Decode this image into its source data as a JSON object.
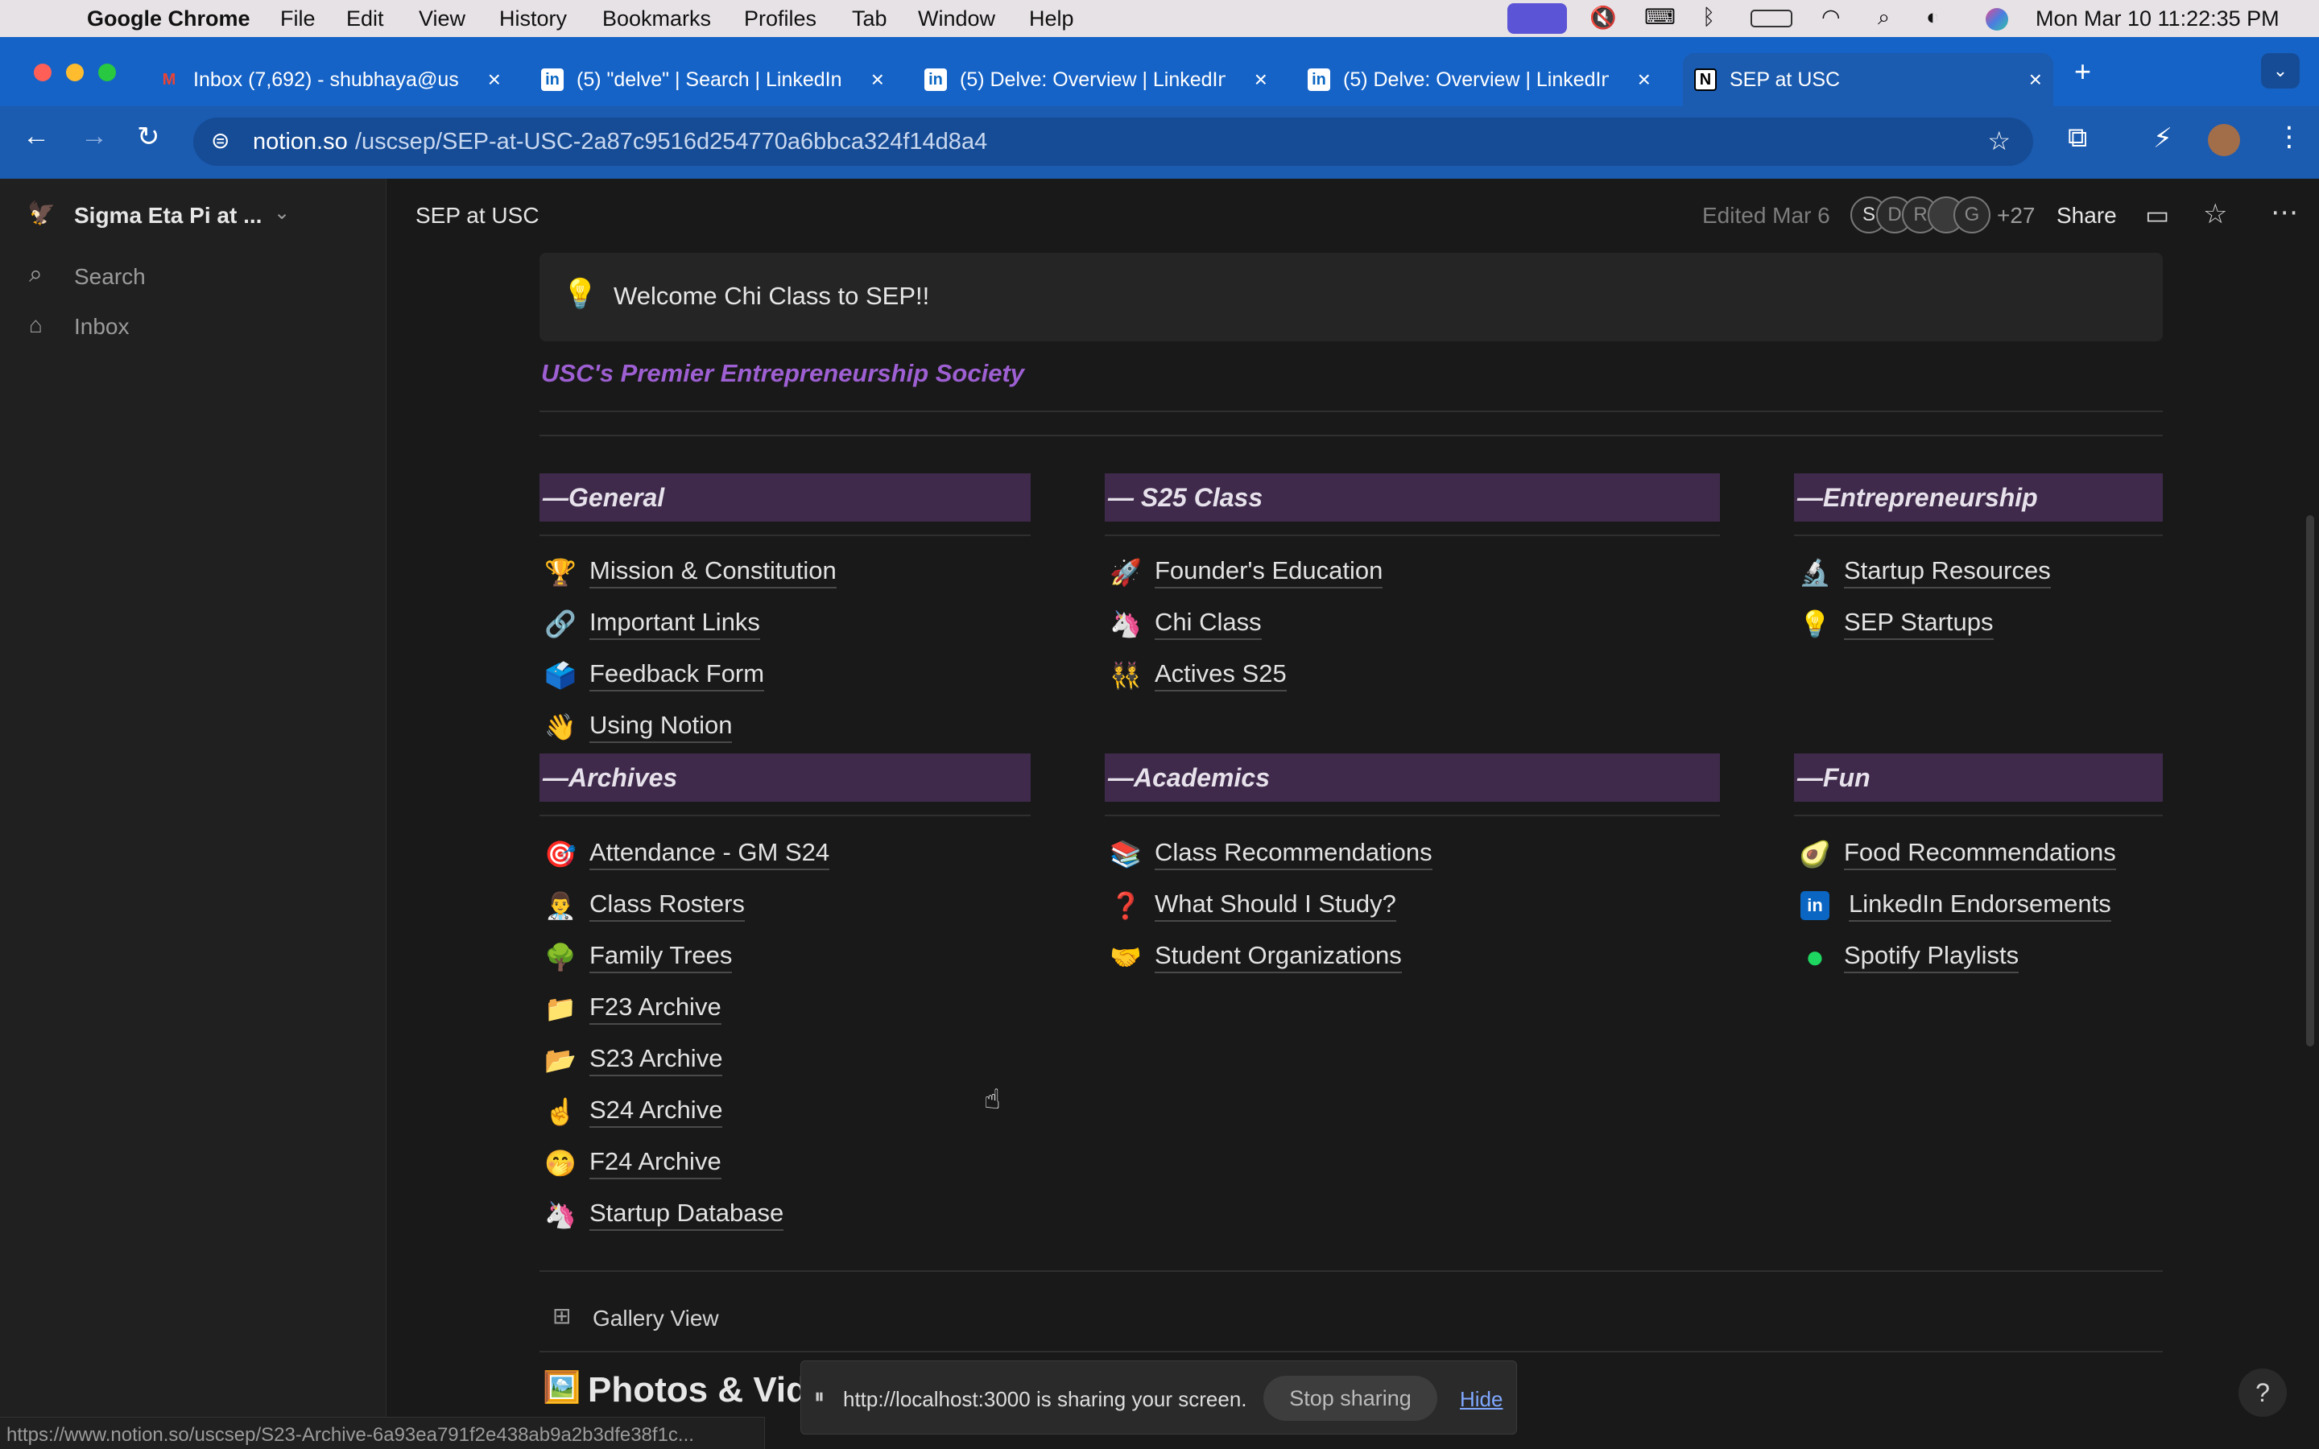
{
  "menubar": {
    "app": "Google Chrome",
    "items": [
      "File",
      "Edit",
      "View",
      "History",
      "Bookmarks",
      "Profiles",
      "Tab",
      "Window",
      "Help"
    ],
    "clock": "Mon Mar 10  11:22:35 PM"
  },
  "tabs": [
    {
      "title": "Inbox (7,692) - shubhaya@us",
      "icon": "gmail-icon"
    },
    {
      "title": "(5) \"delve\" | Search | LinkedIn",
      "icon": "linkedin-icon"
    },
    {
      "title": "(5) Delve: Overview | LinkedIn",
      "icon": "linkedin-icon"
    },
    {
      "title": "(5) Delve: Overview | LinkedIn",
      "icon": "linkedin-icon"
    },
    {
      "title": "SEP at USC",
      "icon": "notion-icon"
    }
  ],
  "omnibox": {
    "domain": "notion.so",
    "path": "/uscsep/SEP-at-USC-2a87c9516d254770a6bbca324f14d8a4"
  },
  "sidebar": {
    "workspace": "Sigma Eta Pi at ...",
    "search": "Search",
    "inbox": "Inbox"
  },
  "topbar": {
    "breadcrumb": "SEP at USC",
    "edited": "Edited Mar 6",
    "avatars": [
      "S",
      "D",
      "R",
      "",
      "G"
    ],
    "extra_count": "+27",
    "share": "Share"
  },
  "callout": {
    "icon": "💡",
    "text": "Welcome Chi Class to SEP!!"
  },
  "tagline": "USC's Premier Entrepreneurship Society",
  "sections": {
    "general": {
      "title": "—General",
      "items": [
        {
          "emoji": "🏆",
          "label": "Mission & Constitution"
        },
        {
          "emoji": "🔗",
          "label": "Important Links"
        },
        {
          "emoji": "🗳️",
          "label": "Feedback Form"
        },
        {
          "emoji": "👋",
          "label": "Using Notion"
        }
      ]
    },
    "s25": {
      "title": "— S25 Class",
      "items": [
        {
          "emoji": "🚀",
          "label": "Founder's Education"
        },
        {
          "emoji": "🦄",
          "label": "Chi Class"
        },
        {
          "emoji": "👯",
          "label": "Actives S25"
        }
      ]
    },
    "entre": {
      "title": "—Entrepreneurship",
      "items": [
        {
          "emoji": "🔬",
          "label": "Startup Resources"
        },
        {
          "emoji": "💡",
          "label": "SEP Startups"
        }
      ]
    },
    "archives": {
      "title": "—Archives",
      "items": [
        {
          "emoji": "🎯",
          "label": "Attendance - GM S24"
        },
        {
          "emoji": "👨‍⚕️",
          "label": "Class Rosters"
        },
        {
          "emoji": "🌳",
          "label": "Family Trees"
        },
        {
          "emoji": "📁",
          "label": "F23 Archive"
        },
        {
          "emoji": "📂",
          "label": "S23 Archive"
        },
        {
          "emoji": "☝️",
          "label": "S24 Archive"
        },
        {
          "emoji": "🤭",
          "label": "F24 Archive"
        },
        {
          "emoji": "🦄",
          "label": "Startup Database"
        }
      ]
    },
    "academics": {
      "title": "—Academics",
      "items": [
        {
          "emoji": "📚",
          "label": "Class Recommendations"
        },
        {
          "emoji": "❓",
          "label": "What Should I Study?"
        },
        {
          "emoji": "🤝",
          "label": "Student Organizations"
        }
      ]
    },
    "fun": {
      "title": "—Fun",
      "items": [
        {
          "emoji": "🥑",
          "label": "Food Recommendations"
        },
        {
          "emoji": "in",
          "label": "LinkedIn Endorsements"
        },
        {
          "emoji": "●",
          "label": "Spotify Playlists"
        }
      ]
    }
  },
  "gallery": {
    "label": "Gallery View",
    "photos_title": "Photos & Vid"
  },
  "sharing": {
    "text": "http://localhost:3000 is sharing your screen.",
    "stop": "Stop sharing",
    "hide": "Hide"
  },
  "statusbar": {
    "url": "https://www.notion.so/uscsep/S23-Archive-6a93ea791f2e438ab9a2b3dfe38f1c..."
  },
  "colors": {
    "accent": "#9d5fd2",
    "section_bg": "#3f2a4c",
    "chrome_blue": "#1b5bb0"
  }
}
